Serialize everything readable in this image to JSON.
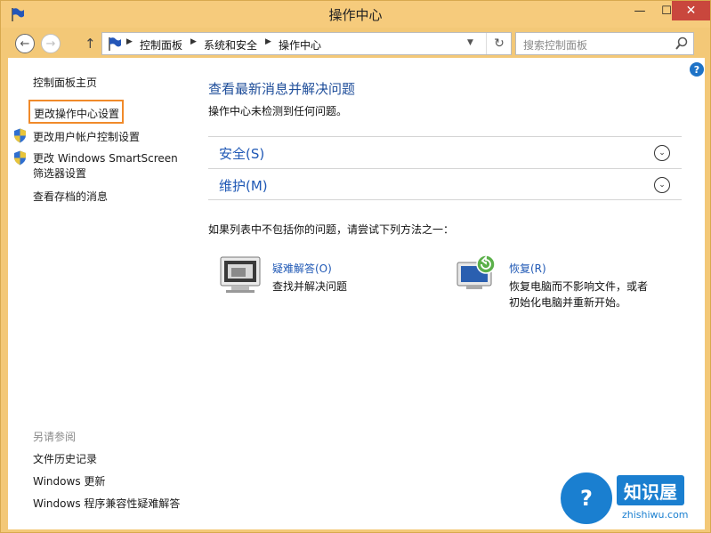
{
  "window": {
    "title": "操作中心",
    "minimize": "—",
    "maximize": "☐",
    "close": "✕"
  },
  "nav": {
    "back": "←",
    "forward": "→",
    "up": "↑",
    "breadcrumbs": [
      "控制面板",
      "系统和安全",
      "操作中心"
    ],
    "separator": "▶",
    "dropdown": "▼",
    "refresh": "↻",
    "search_placeholder": "搜索控制面板"
  },
  "help": "?",
  "sidebar": {
    "home": "控制面板主页",
    "links": [
      "更改操作中心设置",
      "更改用户帐户控制设置",
      "更改 Windows SmartScreen",
      "筛选器设置",
      "查看存档的消息"
    ],
    "see_also_title": "另请参阅",
    "see_also": [
      "文件历史记录",
      "Windows 更新",
      "Windows 程序兼容性疑难解答"
    ]
  },
  "main": {
    "title": "查看最新消息并解决问题",
    "subtitle": "操作中心未检测到任何问题。",
    "sections": [
      "安全(S)",
      "维护(M)"
    ],
    "chevron": "⌄",
    "try_text": "如果列表中不包括你的问题，请尝试下列方法之一：",
    "actions": [
      {
        "link": "疑难解答(O)",
        "desc": "查找并解决问题"
      },
      {
        "link": "恢复(R)",
        "desc_line1": "恢复电脑而不影响文件，或者",
        "desc_line2": "初始化电脑并重新开始。"
      }
    ]
  },
  "watermark": {
    "brand": "知识屋",
    "url": "zhishiwu.com",
    "badge": "?"
  }
}
